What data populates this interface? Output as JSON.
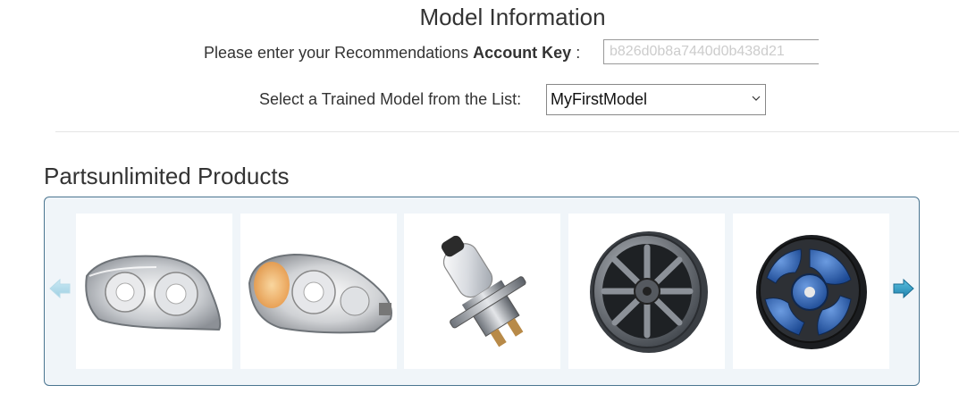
{
  "page": {
    "title": "Model Information"
  },
  "account": {
    "label_prefix": "Please enter your Recommendations ",
    "label_bold": "Account Key",
    "label_suffix": ":",
    "value": "b826d0b8a7440d0b438d21"
  },
  "model": {
    "label": "Select a Trained Model from the List:",
    "selected": "MyFirstModel"
  },
  "products": {
    "heading": "Partsunlimited Products",
    "items": [
      {
        "icon": "headlight-icon"
      },
      {
        "icon": "headlight-amber-icon"
      },
      {
        "icon": "halogen-bulb-icon"
      },
      {
        "icon": "alloy-wheel-gray-icon"
      },
      {
        "icon": "alloy-wheel-blue-icon"
      }
    ]
  },
  "colors": {
    "carousel_border": "#4a7590",
    "carousel_bg": "#f0f5f9",
    "arrow": "#3aa0c8",
    "wheel_blue": "#2b5fb0"
  }
}
